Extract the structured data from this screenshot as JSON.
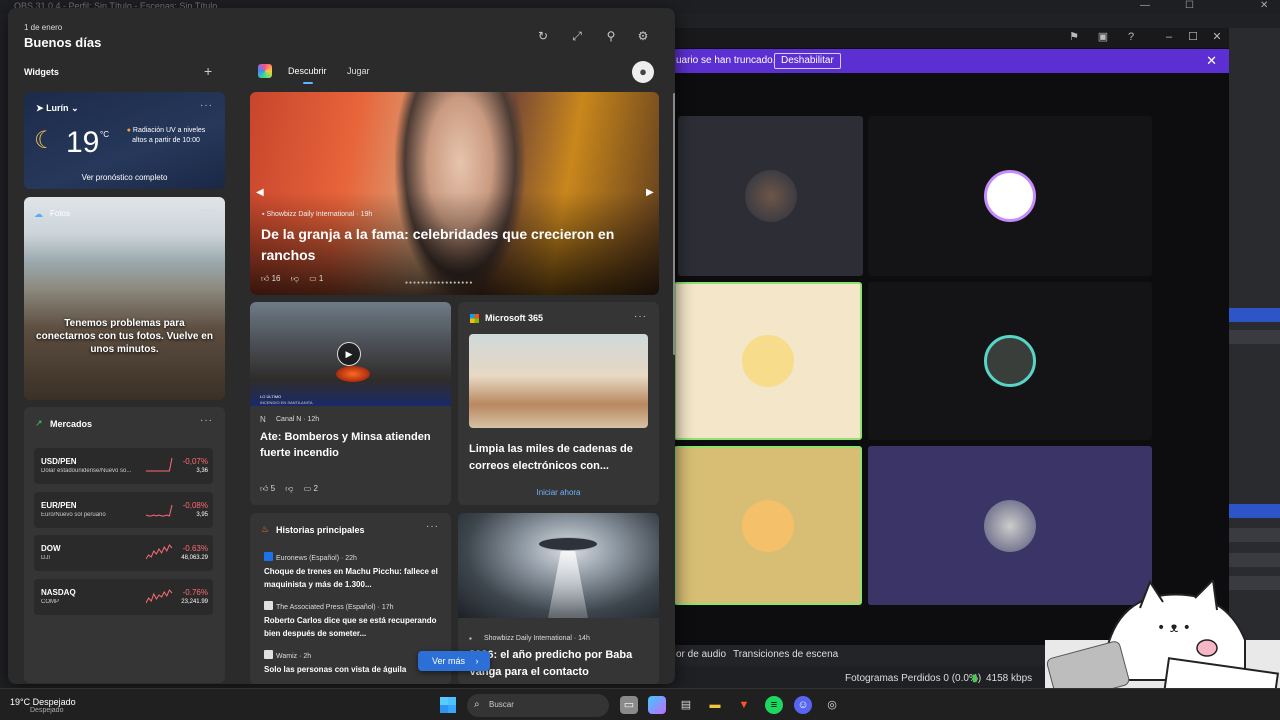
{
  "obs": {
    "title": "OBS 31.0.4 - Perfil: Sin Título - Escenas: Sin Título",
    "banner_msg": "uario se han truncado.",
    "banner_button": "Deshabilitar",
    "bottom_tabs": [
      "or de audio",
      "Transiciones de escena"
    ],
    "status_frames": "Fotogramas Perdidos 0 (0.0%)",
    "status_bitrate": "4158 kbps"
  },
  "widgets": {
    "date": "1 de enero",
    "greeting": "Buenos días",
    "section_label": "Widgets",
    "add_symbol": "+",
    "weather": {
      "location": "Lurín",
      "temp": "19",
      "unit": "°C",
      "uv_text": "Radiación UV a niveles altos a partir de 10:00",
      "link": "Ver pronóstico completo"
    },
    "photos": {
      "label": "Fotos",
      "message": "Tenemos problemas para conectarnos con tus fotos. Vuelve en unos minutos."
    },
    "markets": {
      "label": "Mercados",
      "items": [
        {
          "symbol": "USD/PEN",
          "name": "Dólar estadounidense/Nuevo so...",
          "change": "-0,07%",
          "value": "3,36",
          "spark": [
            5,
            5,
            5,
            5,
            5,
            5,
            5,
            5,
            5,
            5,
            18
          ]
        },
        {
          "symbol": "EUR/PEN",
          "name": "Euro/Nuevo sol peruano",
          "change": "-0,08%",
          "value": "3,95",
          "spark": [
            5,
            4,
            4,
            5,
            4,
            5,
            4,
            4,
            5,
            4,
            15
          ]
        },
        {
          "symbol": "DOW",
          "name": "DJI",
          "change": "-0.63%",
          "value": "48,063.29",
          "spark": [
            4,
            8,
            6,
            12,
            9,
            14,
            10,
            16,
            12,
            18,
            15
          ]
        },
        {
          "symbol": "NASDAQ",
          "name": "COMP",
          "change": "-0.76%",
          "value": "23,241.99",
          "spark": [
            4,
            9,
            6,
            13,
            8,
            12,
            10,
            15,
            11,
            17,
            14
          ]
        }
      ]
    }
  },
  "feed": {
    "tabs": [
      "Descubrir",
      "Jugar"
    ],
    "hero": {
      "source": "Showbizz Daily International · 19h",
      "title": "De la granja a la fama: celebridades que crecieron en ranchos",
      "likes": "16",
      "comments": "1"
    },
    "news": {
      "source": "Canal N · 12h",
      "title": "Ate: Bomberos y Minsa atienden fuerte incendio",
      "tag1": "LO ÚLTIMO",
      "tag2": "INCENDIO EN SANTA ANITA",
      "likes": "5",
      "comments": "2"
    },
    "m365": {
      "label": "Microsoft 365",
      "title": "Limpia las miles de cadenas de correos electrónicos con...",
      "cta": "Iniciar ahora"
    },
    "stories": {
      "label": "Historias principales",
      "items": [
        {
          "source": "Euronews (Español) · 22h",
          "title": "Choque de trenes en Machu Picchu: fallece el maquinista y más de 1.300...",
          "color": "#1a73e8"
        },
        {
          "source": "The Associated Press (Español) · 17h",
          "title": "Roberto Carlos dice que se está recuperando bien después de someter...",
          "color": "#e0e0e0"
        },
        {
          "source": "Wamiz · 2h",
          "title": "Solo las personas con vista de águila",
          "color": "#e0e0e0"
        }
      ]
    },
    "ufo": {
      "source": "Showbizz Daily International · 14h",
      "title": "2026: el año predicho por Baba Vanga para el contacto"
    },
    "see_more": "Ver más"
  },
  "taskbar": {
    "weather": "19°C Despejado",
    "weather_sub": "Despejado",
    "search_placeholder": "Buscar"
  }
}
